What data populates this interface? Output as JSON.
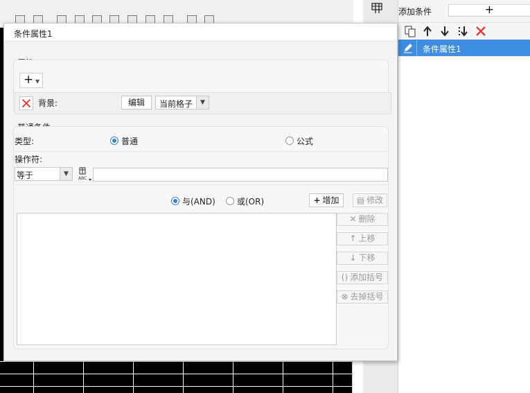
{
  "right_panel": {
    "add_condition_label": "添加条件",
    "add_button_symbol": "+",
    "toolbar_icons": [
      "copy-icon",
      "move-up-icon",
      "move-down-icon",
      "move-bottom-icon",
      "delete-icon"
    ],
    "conditions": [
      {
        "label": "条件属性1",
        "selected": true
      }
    ]
  },
  "dialog": {
    "title": "条件属性1",
    "attributes": {
      "section_label": "属性:",
      "add_symbol": "+",
      "background_label": "背景:",
      "edit_button": "编辑",
      "scope_value": "当前格子"
    },
    "normal_condition": {
      "section_label": "普通条件",
      "type_label": "类型:",
      "type_options": [
        "普通",
        "公式"
      ],
      "type_selected": "普通",
      "operator_label": "操作符:",
      "operator_value": "等于",
      "value_text": "",
      "logic_options": [
        "与(AND)",
        "或(OR)"
      ],
      "logic_selected": "与(AND)",
      "add_button": "增加",
      "modify_button": "修改",
      "delete_button": "删除",
      "move_up_button": "上移",
      "move_down_button": "下移",
      "add_bracket_button": "添加括号",
      "remove_bracket_button": "去掉括号"
    }
  },
  "colors": {
    "selection": "#3d8ee0",
    "delete_red": "#e53935",
    "radio_accent": "#3a7fd9"
  }
}
